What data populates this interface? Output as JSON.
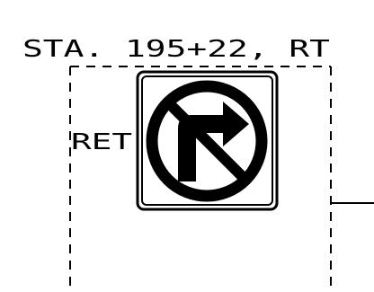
{
  "station_label": "STA. 195+22, RT",
  "side_label": "RET",
  "sign": {
    "type": "no-right-turn",
    "symbol_color": "#000000",
    "background_color": "#ffffff"
  },
  "line_color": "#000000"
}
